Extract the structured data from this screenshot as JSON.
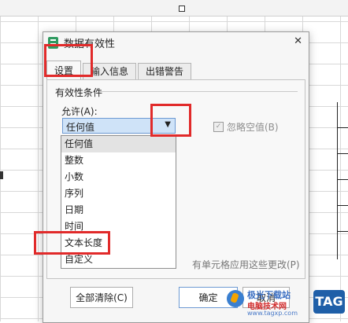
{
  "dialog": {
    "title": "数据有效性",
    "close_glyph": "✕",
    "tabs": [
      {
        "label": "设置"
      },
      {
        "label": "输入信息"
      },
      {
        "label": "出错警告"
      }
    ],
    "section_title": "有效性条件",
    "allow_label": "允许(A):",
    "allow_value": "任何值",
    "ignore_blank_label": "忽略空值(B)",
    "ignore_blank_checked": true,
    "apply_note": "有单元格应用这些更改(P)",
    "dropdown_options": [
      "任何值",
      "整数",
      "小数",
      "序列",
      "日期",
      "时间",
      "文本长度",
      "自定义"
    ],
    "selected_option": "任何值",
    "buttons": {
      "clear": "全部清除(C)",
      "ok": "确定",
      "cancel": "取消"
    }
  },
  "watermark": {
    "line1": "极光下载站",
    "line2": "电脑技术网",
    "line3": "www.tagxp.com",
    "tag": "TAG"
  },
  "colors": {
    "highlight": "#e12a2a",
    "select_bg": "#cfe3f8",
    "app_icon": "#2f9a60"
  },
  "icons": {
    "app": "spreadsheet-icon",
    "close": "close-icon",
    "dropdown": "chevron-down-icon",
    "checkbox": "check-icon"
  }
}
